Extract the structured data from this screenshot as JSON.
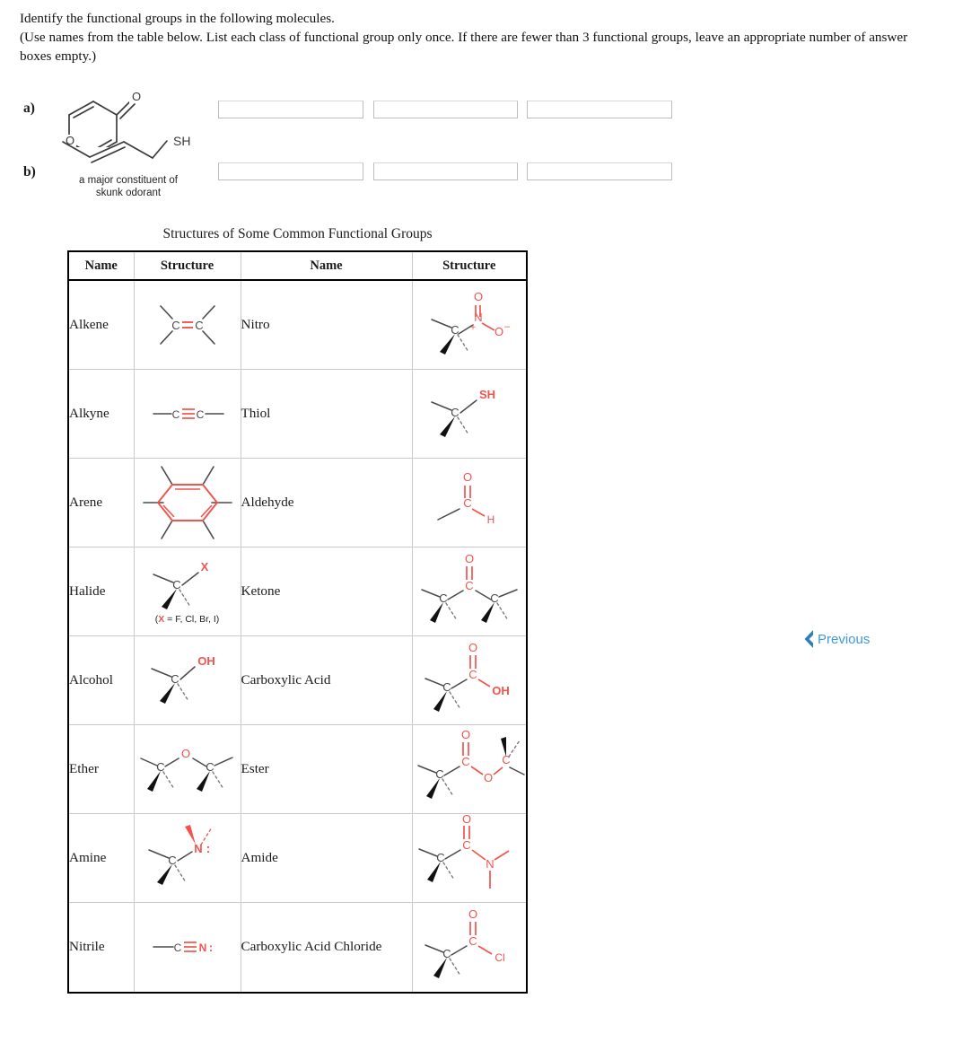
{
  "prompt": {
    "line1": "Identify the functional groups in the following molecules.",
    "line2": "(Use names from the table below. List each class of functional group only once. If there are fewer than 3 functional groups, leave an appropriate number of answer boxes empty.)"
  },
  "questions": [
    {
      "label": "a)",
      "molecule_name": "4H-pyran-4-one",
      "caption": "",
      "answers": [
        {
          "value": "",
          "placeholder": ""
        },
        {
          "value": "",
          "placeholder": ""
        },
        {
          "value": "",
          "placeholder": ""
        }
      ]
    },
    {
      "label": "b)",
      "molecule_name": "2-butene-1-thiol",
      "caption_line1": "a major constituent of",
      "caption_line2": "skunk odorant",
      "answers": [
        {
          "value": "",
          "placeholder": ""
        },
        {
          "value": "",
          "placeholder": ""
        },
        {
          "value": "",
          "placeholder": ""
        }
      ]
    }
  ],
  "navigation": {
    "previous_label": "Previous",
    "previous_icon": "chevron-left-icon"
  },
  "table": {
    "title": "Structures of Some Common Functional Groups",
    "headers": [
      "Name",
      "Structure",
      "Name",
      "Structure"
    ],
    "rows": [
      {
        "left_name": "Alkene",
        "left_struct": "C=C alkene skeletal structure",
        "right_name": "Nitro",
        "right_struct": "C-N(+)(=O)O(-) nitro group"
      },
      {
        "left_name": "Alkyne",
        "left_struct": "C triple bond C alkyne",
        "right_name": "Thiol",
        "right_struct": "C-SH thiol group"
      },
      {
        "left_name": "Arene",
        "left_struct": "benzene ring arene",
        "right_name": "Aldehyde",
        "right_struct": "C(=O)H aldehyde group"
      },
      {
        "left_name": "Halide",
        "left_struct": "C-X halide group",
        "right_name": "Ketone",
        "right_struct": "C-C(=O)-C ketone group",
        "note_prefix": "(",
        "note_x": "X",
        "note_rest": " = F, Cl, Br, I)"
      },
      {
        "left_name": "Alcohol",
        "left_struct": "C-OH alcohol group",
        "right_name": "Carboxylic Acid",
        "right_struct": "C(=O)OH carboxylic acid group"
      },
      {
        "left_name": "Ether",
        "left_struct": "C-O-C ether group",
        "right_name": "Ester",
        "right_struct": "C(=O)-O-C ester group"
      },
      {
        "left_name": "Amine",
        "left_struct": "C-N amine group",
        "right_name": "Amide",
        "right_struct": "C(=O)-N amide group"
      },
      {
        "left_name": "Nitrile",
        "left_struct": "C triple bond N nitrile",
        "right_name": "Carboxylic Acid Chloride",
        "right_struct": "C(=O)Cl acid chloride group"
      }
    ]
  },
  "colors": {
    "highlight_red": "#f2534d",
    "link_blue": "#3e9ad6",
    "chevron_blue": "#2d7fb5",
    "bond_gray": "#4a4a4a",
    "text": "#1a1a1a"
  }
}
